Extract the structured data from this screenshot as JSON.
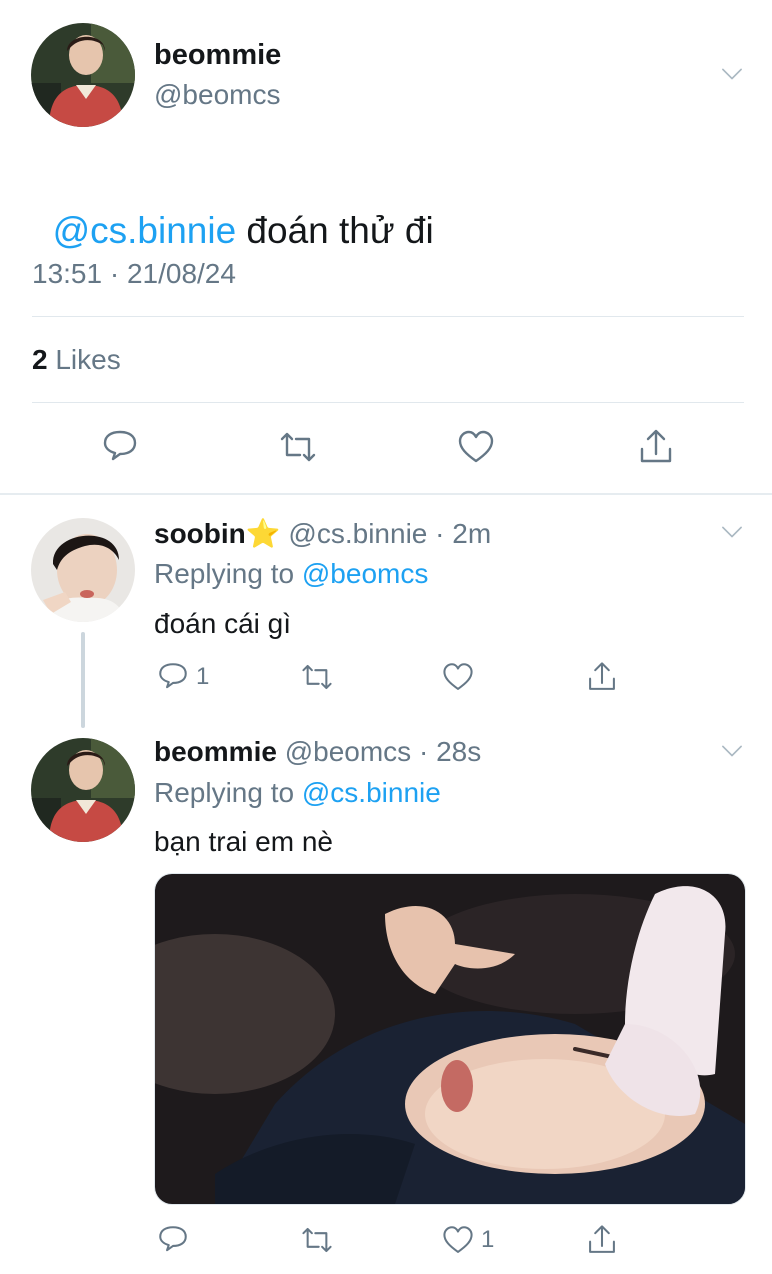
{
  "main_tweet": {
    "display_name": "beommie",
    "handle": "@beomcs",
    "mention": "@cs.binnie",
    "text": " đoán thử đi",
    "timestamp": "13:51 · 21/08/24",
    "likes_count": "2",
    "likes_label": "Likes"
  },
  "replies": [
    {
      "display_name": "soobin",
      "emoji": "⭐",
      "handle": "@cs.binnie",
      "time": "· 2m",
      "replying_label": "Replying to",
      "replying_to": "@beomcs",
      "text": "đoán cái gì",
      "reply_count": "1",
      "like_count": ""
    },
    {
      "display_name": "beommie",
      "handle": "@beomcs",
      "time": "· 28s",
      "replying_label": "Replying to",
      "replying_to": "@cs.binnie",
      "text": "bạn trai em nè",
      "reply_count": "",
      "like_count": "1"
    }
  ],
  "colors": {
    "link": "#1da1f2",
    "secondary": "#657786",
    "divider": "#e1e8ed"
  },
  "icons": [
    "chevron-down-icon",
    "reply-icon",
    "retweet-icon",
    "like-icon",
    "share-icon"
  ]
}
